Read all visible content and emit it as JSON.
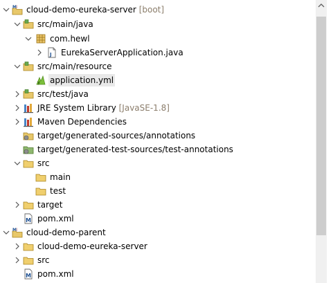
{
  "tree": {
    "items": [
      {
        "label": "cloud-demo-eureka-server",
        "suffix": "[boot]",
        "icon": "maven-project-icon",
        "expanded": true
      },
      {
        "label": "src/main/java",
        "icon": "source-folder-icon",
        "expanded": true
      },
      {
        "label": "com.hewl",
        "icon": "package-icon",
        "expanded": true
      },
      {
        "label": "EurekaServerApplication.java",
        "icon": "java-file-icon",
        "expanded": false
      },
      {
        "label": "src/main/resource",
        "icon": "source-folder-icon",
        "expanded": true
      },
      {
        "label": "application.yml",
        "icon": "yaml-file-icon",
        "selected": true
      },
      {
        "label": "src/test/java",
        "icon": "source-folder-icon",
        "expanded": false
      },
      {
        "label": "JRE System Library",
        "suffix": "[JavaSE-1.8]",
        "icon": "library-icon",
        "expanded": false
      },
      {
        "label": "Maven Dependencies",
        "icon": "library-icon",
        "expanded": false
      },
      {
        "label": "target/generated-sources/annotations",
        "icon": "generated-folder-icon"
      },
      {
        "label": "target/generated-test-sources/test-annotations",
        "icon": "generated-folder-icon"
      },
      {
        "label": "src",
        "icon": "folder-icon",
        "expanded": true
      },
      {
        "label": "main",
        "icon": "folder-icon"
      },
      {
        "label": "test",
        "icon": "folder-icon"
      },
      {
        "label": "target",
        "icon": "folder-icon",
        "expanded": false
      },
      {
        "label": "pom.xml",
        "icon": "pom-file-icon"
      },
      {
        "label": "cloud-demo-parent",
        "icon": "maven-project-icon",
        "expanded": true
      },
      {
        "label": "cloud-demo-eureka-server",
        "icon": "folder-icon",
        "expanded": false
      },
      {
        "label": "src",
        "icon": "folder-icon",
        "expanded": false
      },
      {
        "label": "pom.xml",
        "icon": "pom-file-icon"
      }
    ]
  },
  "scrollbar": {
    "position": 0.05,
    "visible_fraction": 0.78
  }
}
